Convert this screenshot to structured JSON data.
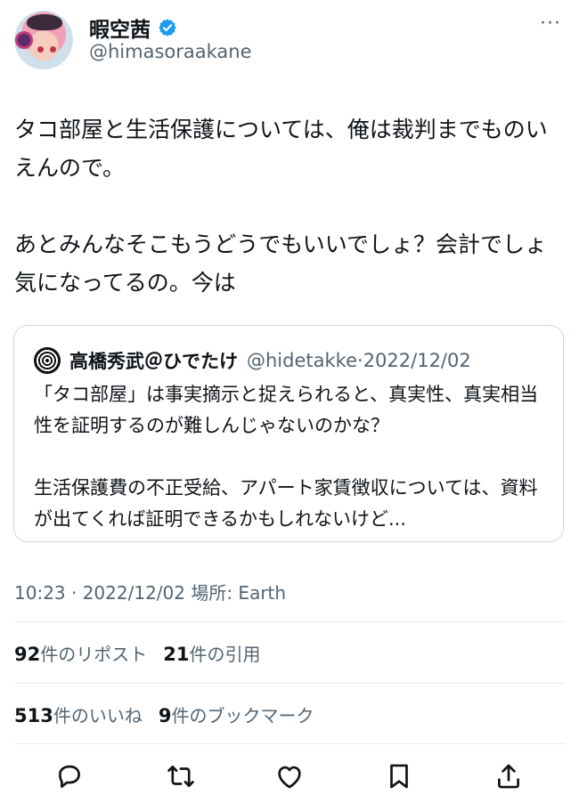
{
  "header": {
    "display_name": "暇空茜",
    "handle": "@himasoraakane",
    "more_label": "···"
  },
  "tweet": {
    "paragraphs": [
      "タコ部屋と生活保護については、俺は裁判までものいえんので。",
      "あとみんなそこもうどうでもいいでしょ？会計でしょ気になってるの。今は"
    ]
  },
  "quote": {
    "name": "高橋秀武＠ひでたけ",
    "handle": "@hidetakke",
    "separator": "·",
    "date": "2022/12/02",
    "paragraphs": [
      "「タコ部屋」は事実摘示と捉えられると、真実性、真実相当性を証明するのが難しんじゃないのかな？",
      "生活保護費の不正受給、アパート家賃徴収については、資料が出てくれば証明できるかもしれないけど..."
    ]
  },
  "meta": {
    "line": "10:23 · 2022/12/02 場所: Earth"
  },
  "stats": {
    "reposts_count": "92",
    "reposts_label": "件のリポスト",
    "quotes_count": "21",
    "quotes_label": "件の引用",
    "likes_count": "513",
    "likes_label": "件のいいね",
    "bookmarks_count": "9",
    "bookmarks_label": "件のブックマーク"
  },
  "actions": {
    "icons": [
      "reply-icon",
      "repost-icon",
      "like-icon",
      "bookmark-icon",
      "share-icon"
    ]
  },
  "colors": {
    "text": "#0f1419",
    "secondary": "#536471",
    "verified": "#1d9bf0",
    "border": "#cfd9de"
  }
}
